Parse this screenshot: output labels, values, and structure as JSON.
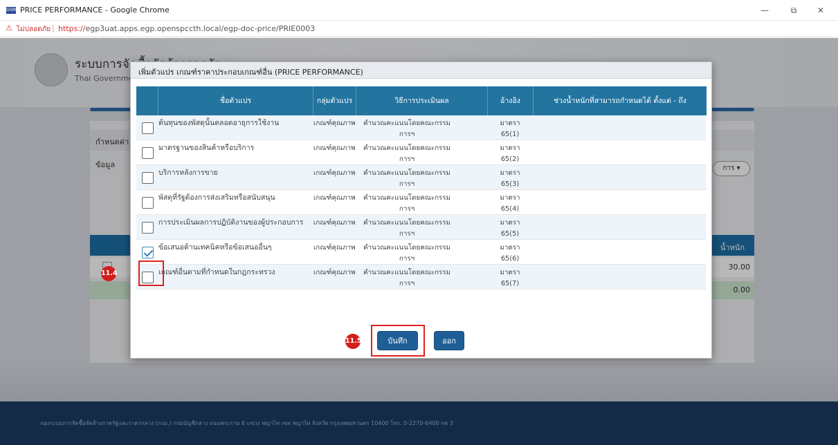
{
  "window": {
    "title": "PRICE PERFORMANCE - Google Chrome",
    "app_icon_text": "GSM",
    "controls": {
      "minimize": "—",
      "maximize": "⧉",
      "close": "✕"
    }
  },
  "address_bar": {
    "warning_icon": "⚠",
    "insecure_label": "ไม่ปลอดภัย",
    "separator": "|",
    "url_scheme": "https://",
    "url_rest": "egp3uat.apps.egp.openspccth.local/egp-doc-price/PRIE0003"
  },
  "background_page": {
    "system_title": "ระบบการจัดซื้อจัดจ้างภาครัฐ",
    "system_subtitle": "Thai Government Procurement",
    "section_label": "กำหนดค่า",
    "subsection_label": "ข้อมูล",
    "pill_label": "การ ▾",
    "grid_header_right": "น้ำหนัก",
    "grid_row_value": "30.00",
    "grid_total_value": "0.00",
    "footer_text": "กองระบบการจัดซื้อจัดจ้างภาครัฐและราคากลาง (กรม.) กรมบัญชีกลาง ถนนพระราม 6 แขวง พญาไท เขต พญาไท จังหวัด กรุงเทพมหานคร 10400 โทร. 0-2270-6400 กด 3"
  },
  "modal": {
    "title": "เพิ่มตัวแปร เกณฑ์ราคาประกอบเกณฑ์อื่น (PRICE PERFORMANCE)",
    "columns": {
      "name": "ชื่อตัวแปร",
      "group": "กลุ่มตัวแปร",
      "method": "วิธีการประเมินผล",
      "ref": "อ้างอิง",
      "range": "ช่วงน้ำหนักที่สามารถกำหนดได้ ตั้งแต่ - ถึง"
    },
    "rows": [
      {
        "name": "ต้นทุนของพัสดุนั้นตลอดอายุการใช้งาน",
        "group": "เกณฑ์คุณภาพ",
        "method_line1": "คำนวณคะแนนโดยคณะกรรม",
        "method_line2": "การฯ",
        "ref_line1": "มาตรา",
        "ref_line2": "65(1)",
        "range": "",
        "checked": false
      },
      {
        "name": "มาตรฐานของสินค้าหรือบริการ",
        "group": "เกณฑ์คุณภาพ",
        "method_line1": "คำนวณคะแนนโดยคณะกรรม",
        "method_line2": "การฯ",
        "ref_line1": "มาตรา",
        "ref_line2": "65(2)",
        "range": "",
        "checked": false
      },
      {
        "name": "บริการหลังการขาย",
        "group": "เกณฑ์คุณภาพ",
        "method_line1": "คำนวณคะแนนโดยคณะกรรม",
        "method_line2": "การฯ",
        "ref_line1": "มาตรา",
        "ref_line2": "65(3)",
        "range": "",
        "checked": false
      },
      {
        "name": "พัสดุที่รัฐต้องการส่งเสริมหรือสนับสนุน",
        "group": "เกณฑ์คุณภาพ",
        "method_line1": "คำนวณคะแนนโดยคณะกรรม",
        "method_line2": "การฯ",
        "ref_line1": "มาตรา",
        "ref_line2": "65(4)",
        "range": "",
        "checked": false
      },
      {
        "name": "การประเมินผลการปฏิบัติงานของผู้ประกอบการ",
        "group": "เกณฑ์คุณภาพ",
        "method_line1": "คำนวณคะแนนโดยคณะกรรม",
        "method_line2": "การฯ",
        "ref_line1": "มาตรา",
        "ref_line2": "65(5)",
        "range": "",
        "checked": false
      },
      {
        "name": "ข้อเสนอด้านเทคนิคหรือข้อเสนออื่นๆ",
        "group": "เกณฑ์คุณภาพ",
        "method_line1": "คำนวณคะแนนโดยคณะกรรม",
        "method_line2": "การฯ",
        "ref_line1": "มาตรา",
        "ref_line2": "65(6)",
        "range": "",
        "checked": true
      },
      {
        "name": "เกณฑ์อื่นตามที่กำหนดในกฎกระทรวง",
        "group": "เกณฑ์คุณภาพ",
        "method_line1": "คำนวณคะแนนโดยคณะกรรม",
        "method_line2": "การฯ",
        "ref_line1": "มาตรา",
        "ref_line2": "65(7)",
        "range": "",
        "checked": false
      }
    ],
    "save_label": "บันทึก",
    "exit_label": "ออก"
  },
  "annotations": {
    "step_checkbox": "11.4",
    "step_save": "11.5"
  }
}
